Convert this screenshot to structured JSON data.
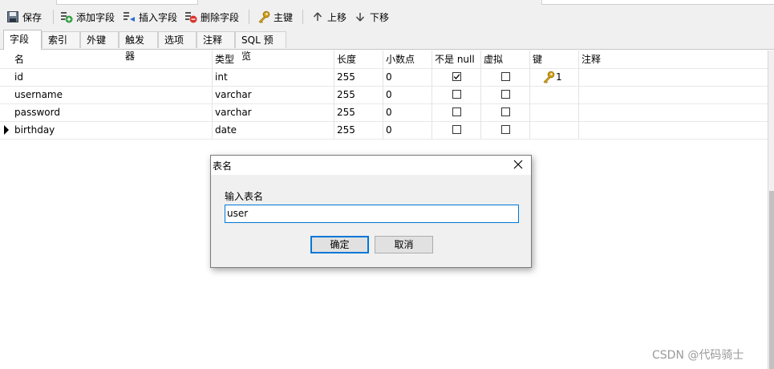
{
  "toolbar": {
    "save": "保存",
    "add_field": "添加字段",
    "insert_field": "插入字段",
    "delete_field": "删除字段",
    "primary_key": "主键",
    "move_up": "上移",
    "move_down": "下移"
  },
  "tabs": [
    "字段",
    "索引",
    "外键",
    "触发器",
    "选项",
    "注释",
    "SQL 预览"
  ],
  "columns": [
    "名",
    "类型",
    "长度",
    "小数点",
    "不是 null",
    "虚拟",
    "键",
    "注释"
  ],
  "rows": [
    {
      "name": "id",
      "type": "int",
      "length": "255",
      "decimals": "0",
      "not_null": true,
      "virtual": false,
      "key": "1",
      "comment": ""
    },
    {
      "name": "username",
      "type": "varchar",
      "length": "255",
      "decimals": "0",
      "not_null": false,
      "virtual": false,
      "key": "",
      "comment": ""
    },
    {
      "name": "password",
      "type": "varchar",
      "length": "255",
      "decimals": "0",
      "not_null": false,
      "virtual": false,
      "key": "",
      "comment": ""
    },
    {
      "name": "birthday",
      "type": "date",
      "length": "255",
      "decimals": "0",
      "not_null": false,
      "virtual": false,
      "key": "",
      "comment": ""
    }
  ],
  "dialog": {
    "title": "表名",
    "label": "输入表名",
    "value": "user",
    "ok": "确定",
    "cancel": "取消"
  },
  "watermark": "CSDN @代码骑士",
  "colors": {
    "accent": "#0078d7",
    "key_gold": "#d4a017",
    "add_green": "#2e9e3e",
    "delete_red": "#d9342b",
    "insert_blue": "#2a6fcf"
  }
}
